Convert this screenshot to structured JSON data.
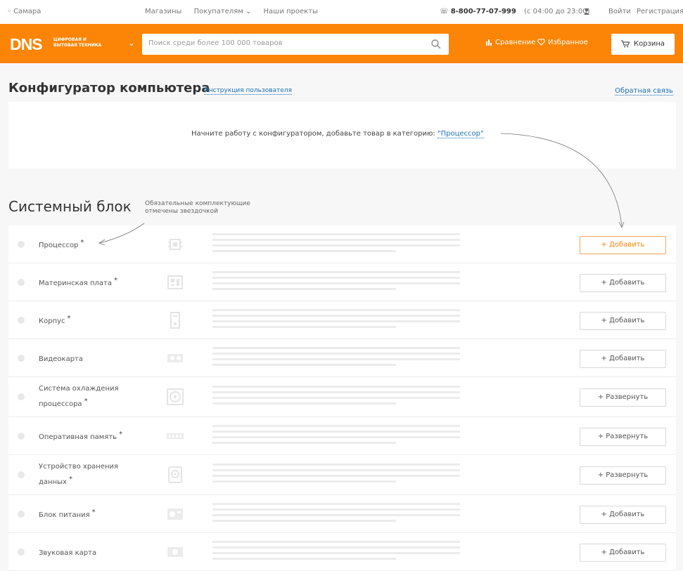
{
  "topbar": {
    "city": "Самара",
    "links": [
      "Магазины",
      "Покупателям ⌄",
      "Наши проекты"
    ],
    "phone": "8-800-77-07-999",
    "hours": "(с 04:00 до 23:00)",
    "login": "Войти",
    "register": "Регистрация"
  },
  "header": {
    "logo_text": "DNS",
    "logo_tagline_1": "ЦИФРОВАЯ И",
    "logo_tagline_2": "БЫТОВАЯ ТЕХНИКА",
    "search_placeholder": "Поиск среди более 100 000 товаров",
    "compare": "Сравнение",
    "favorites": "Избранное",
    "cart": "Корзина"
  },
  "page": {
    "title": "Конфигуратор компьютера",
    "instructions": "Инструкция пользователя",
    "feedback": "Обратная связь",
    "hint_prefix": "Начните работу с конфигуратором, добавьте товар в категорию:",
    "hint_category": "\"Процессор\""
  },
  "section": {
    "title": "Системный блок",
    "note": "Обязательные комплектующие отмечены звездочкой"
  },
  "rows": [
    {
      "name": "Процессор",
      "required": "*",
      "button": "+ Добавить"
    },
    {
      "name": "Материнская плата",
      "required": "*",
      "button": "+ Добавить"
    },
    {
      "name": "Корпус",
      "required": "*",
      "button": "+ Добавить"
    },
    {
      "name": "Видеокарта",
      "required": "",
      "button": "+ Добавить"
    },
    {
      "name": "Система охлаждения процессора",
      "required": "*",
      "button": "+ Развернуть"
    },
    {
      "name": "Оперативная память",
      "required": "*",
      "button": "+ Развернуть"
    },
    {
      "name": "Устройство хранения данных",
      "required": "*",
      "button": "+ Развернуть"
    },
    {
      "name": "Блок питания",
      "required": "*",
      "button": "+ Добавить"
    },
    {
      "name": "Звуковая карта",
      "required": "",
      "button": "+ Добавить"
    }
  ],
  "colors": {
    "brand": "#fc8507",
    "link": "#1a70b8"
  }
}
